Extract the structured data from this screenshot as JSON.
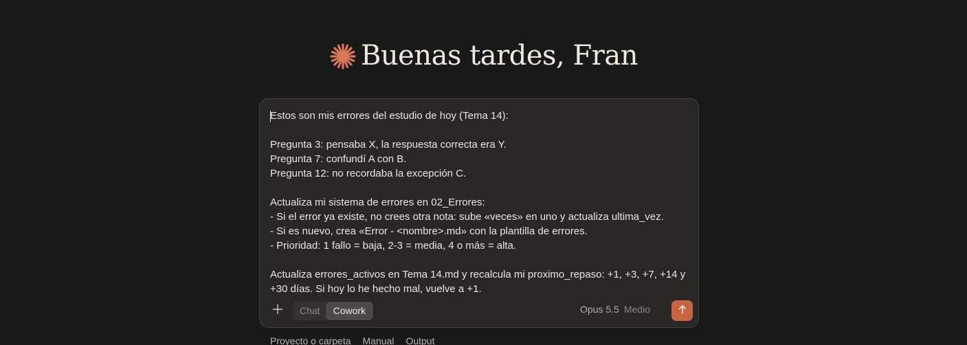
{
  "greeting": {
    "logo_icon": "spark-asterisk-icon",
    "title": "Buenas tardes, Fran"
  },
  "composer": {
    "lines": [
      "Estos son mis errores del estudio de hoy (Tema 14):",
      "",
      "Pregunta 3: pensaba X, la respuesta correcta era Y.",
      "Pregunta 7: confundí A con B.",
      "Pregunta 12: no recordaba la excepción C.",
      "",
      "Actualiza mi sistema de errores en 02_Errores:",
      "- Si el error ya existe, no crees otra nota: sube «veces» en uno y actualiza ultima_vez.",
      "- Si es nuevo, crea «Error - <nombre>.md» con la plantilla de errores.",
      "- Prioridad: 1 fallo = baja, 2-3 = media, 4 o más = alta.",
      "",
      "Actualiza errores_activos en Tema 14.md y recalcula mi proximo_repaso: +1, +3, +7, +14 y",
      "+30 días. Si hoy lo he hecho mal, vuelve a +1."
    ],
    "toolbar": {
      "add_icon": "plus-icon",
      "modes": [
        "Chat",
        "Cowork"
      ],
      "active_mode": "Cowork",
      "model": "Opus 5.5",
      "effort": "Medio",
      "send_icon": "arrow-up-icon"
    },
    "colors": {
      "accent": "#c96442",
      "background": "#1a1919",
      "composer_bg": "#282726"
    }
  },
  "chips": [
    "Proyecto o carpeta",
    "Manual",
    "Output"
  ]
}
